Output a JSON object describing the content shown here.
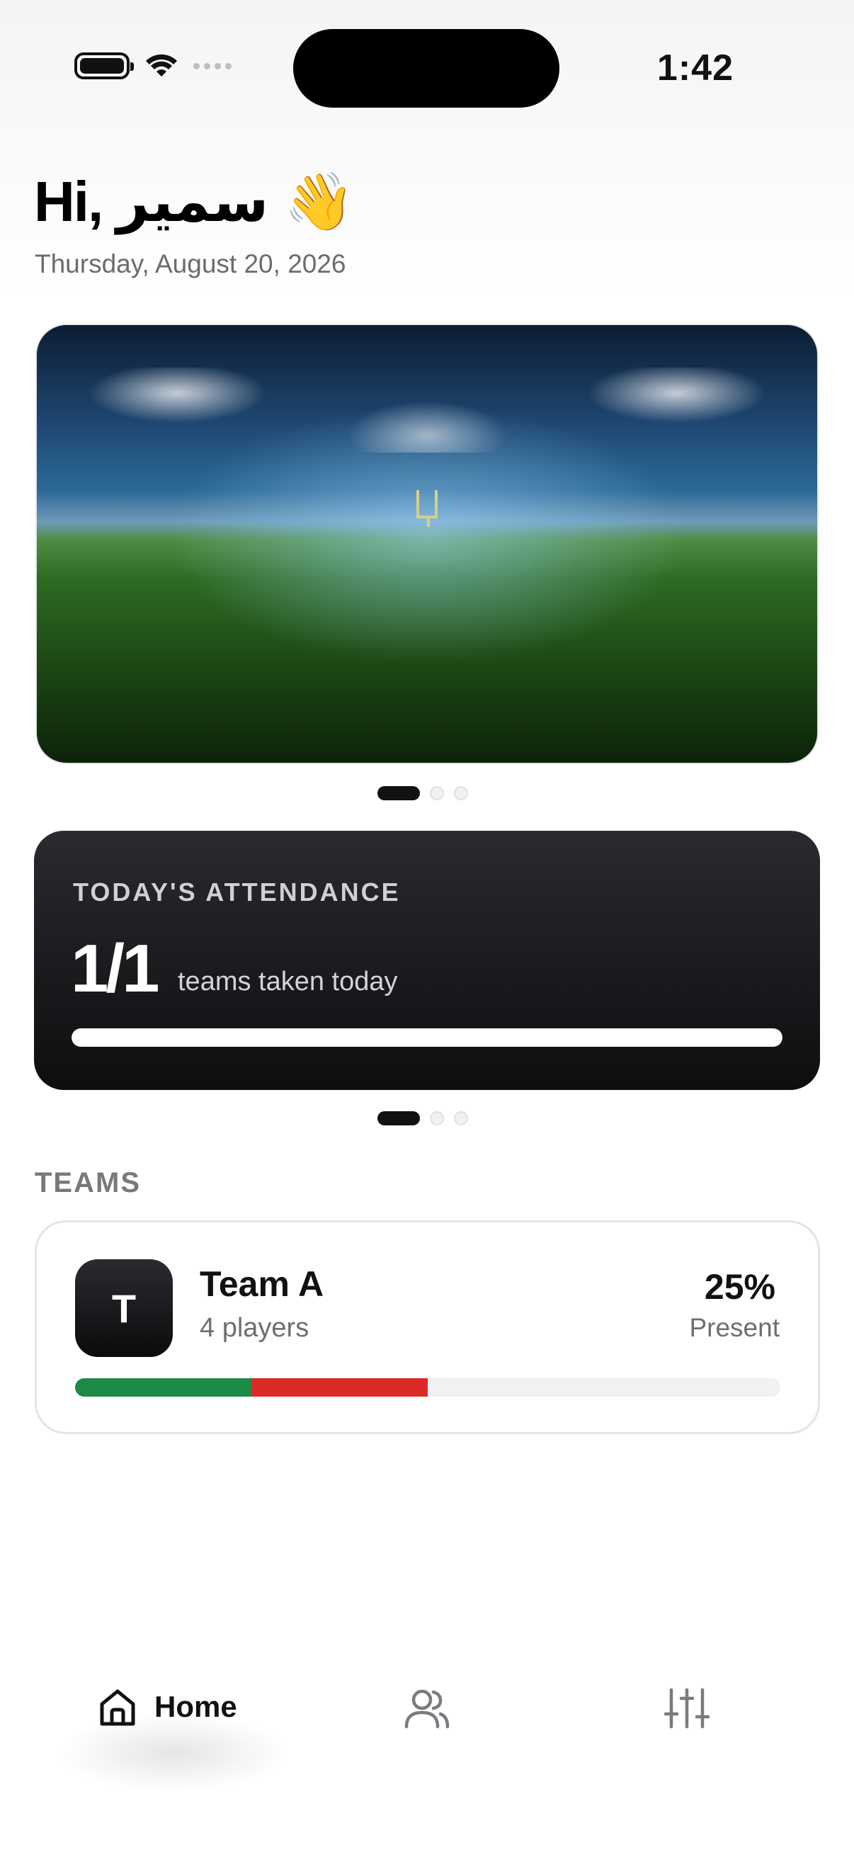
{
  "status_bar": {
    "time": "1:42",
    "battery": "battery-full-icon",
    "wifi": "wifi-icon",
    "signal": "signal-dots-icon"
  },
  "header": {
    "greeting": "Hi, سمير 👋",
    "date": "Thursday, August 20, 2026"
  },
  "hero": {
    "image": "stadium-photo",
    "pager": {
      "count": 3,
      "active_index": 0
    }
  },
  "attendance": {
    "title": "TODAY'S ATTENDANCE",
    "count": "1/1",
    "subtitle": "teams taken today",
    "progress_fraction": 1.0,
    "pager": {
      "count": 3,
      "active_index": 0
    }
  },
  "teams": {
    "section_title": "TEAMS",
    "items": [
      {
        "avatar_letter": "T",
        "name": "Team A",
        "players": "4 players",
        "percent": "25%",
        "percent_label": "Present",
        "present_fraction": 0.25,
        "absent_fraction": 0.25
      }
    ]
  },
  "tabbar": {
    "home_label": "Home",
    "icons": [
      "home-icon",
      "users-icon",
      "sliders-icon"
    ]
  },
  "colors": {
    "present": "#1d8a46",
    "absent": "#dc2a26",
    "card_dark": "#111111"
  }
}
